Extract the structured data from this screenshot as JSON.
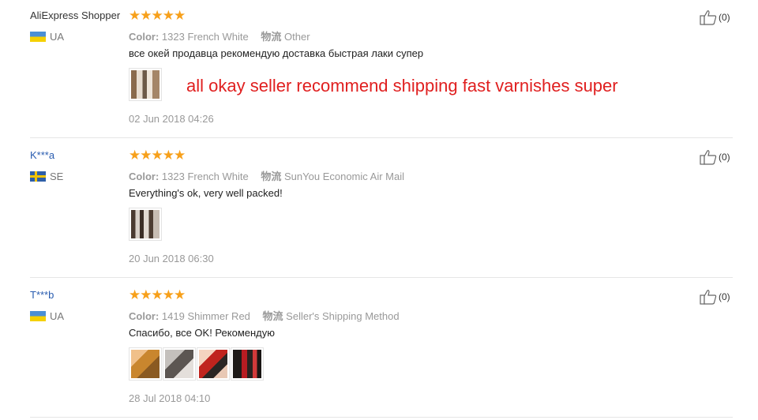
{
  "reviews": [
    {
      "user": "AliExpress Shopper",
      "country_code": "UA",
      "rating": "★★★★★",
      "color_key": "Color:",
      "color_value": "1323 French White",
      "logistics_key": "物流",
      "logistics_value": "Other",
      "feedback": "все окей продавца рекомендую доставка быстрая лаки супер",
      "translation": "all okay seller recommend shipping fast varnishes super",
      "date": "02 Jun 2018 04:26",
      "useful": "(0)"
    },
    {
      "user": "K***a",
      "country_code": "SE",
      "rating": "★★★★★",
      "color_key": "Color:",
      "color_value": "1323 French White",
      "logistics_key": "物流",
      "logistics_value": "SunYou Economic Air Mail",
      "feedback": "Everything's ok, very well packed!",
      "date": "20 Jun 2018 06:30",
      "useful": "(0)"
    },
    {
      "user": "T***b",
      "country_code": "UA",
      "rating": "★★★★★",
      "color_key": "Color:",
      "color_value": "1419 Shimmer Red",
      "logistics_key": "物流",
      "logistics_value": "Seller's Shipping Method",
      "feedback": "Спасибо, все OK! Рекомендую",
      "date": "28 Jul 2018 04:10",
      "useful": "(0)"
    }
  ],
  "colors": {
    "star": "#f7a01a",
    "translation": "#e01f1f",
    "masked_user": "#2a5db0",
    "muted": "#999999"
  }
}
